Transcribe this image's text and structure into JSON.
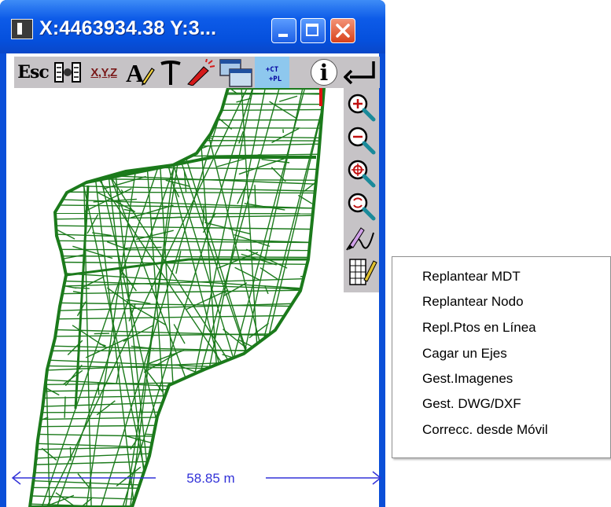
{
  "window": {
    "title": "X:4463934.38 Y:3..."
  },
  "toolbar": {
    "esc_label": "Esc",
    "xyz_label": "X,Y,Z",
    "ct_label": "+CT",
    "pl_label": "+PL",
    "info_label": "i"
  },
  "side_tools": [
    "zoom-in-icon",
    "zoom-out-icon",
    "zoom-pan-icon",
    "zoom-refresh-icon",
    "draw-polyline-icon",
    "table-edit-icon"
  ],
  "map": {
    "measure_label": "58.85 m",
    "mesh_color": "#1b7a1b",
    "measure_color": "#3232d8"
  },
  "context_menu": {
    "items": [
      "Replantear MDT",
      "Replantear Nodo",
      "Repl.Ptos en Línea",
      "Cagar un Ejes",
      "Gest.Imagenes",
      "Gest. DWG/DXF",
      "Correcc. desde Móvil"
    ]
  }
}
